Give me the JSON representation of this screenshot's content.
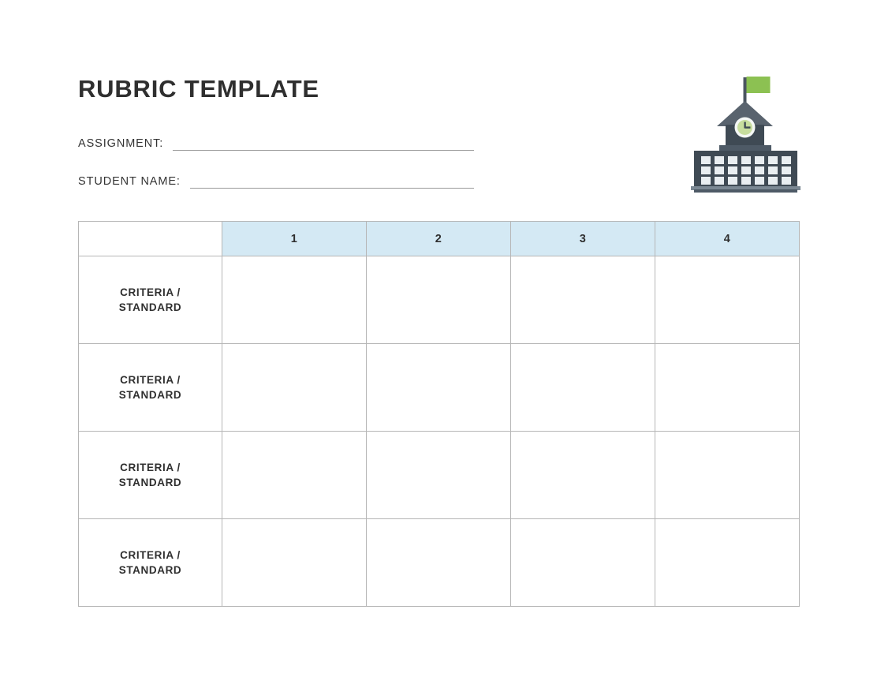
{
  "document": {
    "title": "RUBRIC TEMPLATE",
    "background_color": "#ffffff",
    "text_color": "#2f2f2f"
  },
  "fields": [
    {
      "label": "ASSIGNMENT:",
      "value": "",
      "placeholder": ""
    },
    {
      "label": "STUDENT NAME:",
      "value": "",
      "placeholder": ""
    }
  ],
  "illustration": {
    "name": "school-building-icon",
    "colors": {
      "building": "#3f4a54",
      "building_light": "#4e5a66",
      "roof": "#59636e",
      "base": "#7b8893",
      "window": "#e9eef1",
      "flag": "#8cc152",
      "pole": "#4b5560",
      "clock_face": "#f4f7f5",
      "clock_inner": "#c7dd9e",
      "clock_hands": "#3f4a54"
    }
  },
  "table": {
    "header_fill": "#d4e9f4",
    "border_color": "#b6b6b6",
    "columns": [
      "",
      "1",
      "2",
      "3",
      "4"
    ],
    "rows": [
      {
        "criteria_label": "CRITERIA /\nSTANDARD",
        "cells": [
          "",
          "",
          "",
          ""
        ]
      },
      {
        "criteria_label": "CRITERIA /\nSTANDARD",
        "cells": [
          "",
          "",
          "",
          ""
        ]
      },
      {
        "criteria_label": "CRITERIA /\nSTANDARD",
        "cells": [
          "",
          "",
          "",
          ""
        ]
      },
      {
        "criteria_label": "CRITERIA /\nSTANDARD",
        "cells": [
          "",
          "",
          "",
          ""
        ]
      }
    ]
  }
}
